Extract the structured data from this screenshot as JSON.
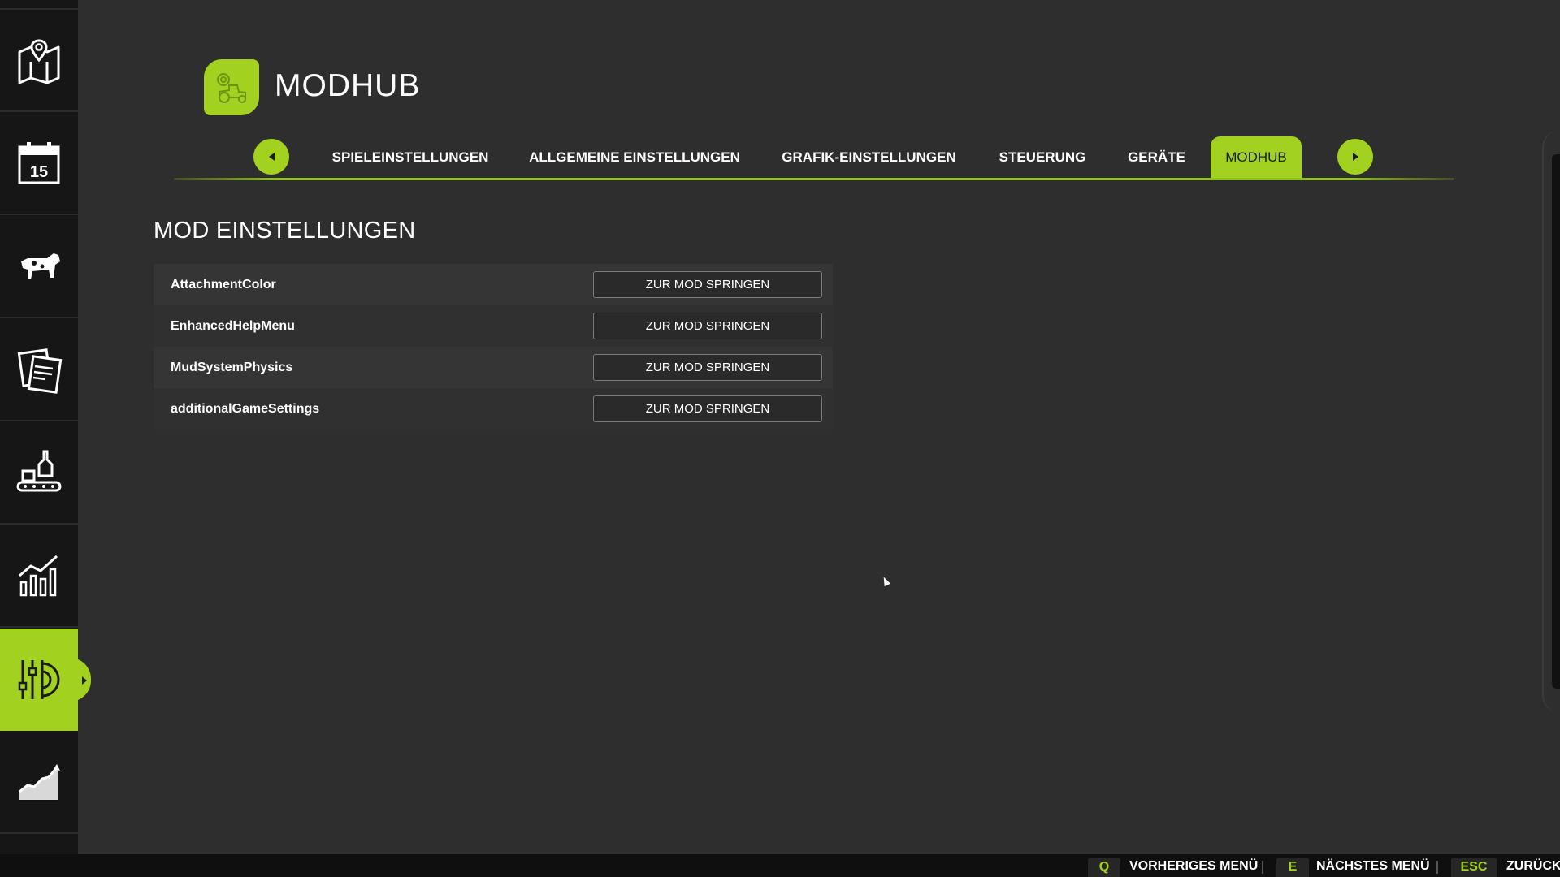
{
  "header": {
    "title": "MODHUB"
  },
  "tabs": {
    "prev_icon": "arrow-left-icon",
    "next_icon": "arrow-right-icon",
    "items": [
      {
        "label": "SPIELEINSTELLUNGEN"
      },
      {
        "label": "ALLGEMEINE EINSTELLUNGEN"
      },
      {
        "label": "GRAFIK-EINSTELLUNGEN"
      },
      {
        "label": "STEUERUNG"
      },
      {
        "label": "GERÄTE"
      },
      {
        "label": "MODHUB",
        "active": true
      }
    ]
  },
  "sidebar": {
    "items": [
      {
        "icon": "map-icon"
      },
      {
        "icon": "calendar-icon",
        "text": "15"
      },
      {
        "icon": "cow-icon"
      },
      {
        "icon": "contracts-icon"
      },
      {
        "icon": "production-icon"
      },
      {
        "icon": "statistics-icon"
      },
      {
        "icon": "settings-icon",
        "active": true
      },
      {
        "icon": "finances-icon"
      }
    ]
  },
  "section": {
    "title": "MOD EINSTELLUNGEN",
    "mods": [
      {
        "name": "AttachmentColor",
        "button": "ZUR MOD SPRINGEN"
      },
      {
        "name": "EnhancedHelpMenu",
        "button": "ZUR MOD SPRINGEN"
      },
      {
        "name": "MudSystemPhysics",
        "button": "ZUR MOD SPRINGEN"
      },
      {
        "name": "additionalGameSettings",
        "button": "ZUR MOD SPRINGEN"
      }
    ]
  },
  "footer": {
    "prev": {
      "key": "Q",
      "label": "VORHERIGES MENÜ"
    },
    "next": {
      "key": "E",
      "label": "NÄCHSTES MENÜ"
    },
    "back": {
      "key": "ESC",
      "label": "ZURÜCK"
    }
  },
  "colors": {
    "accent": "#a2d21f",
    "background": "#2e2e2e",
    "sidebar": "#161616"
  }
}
